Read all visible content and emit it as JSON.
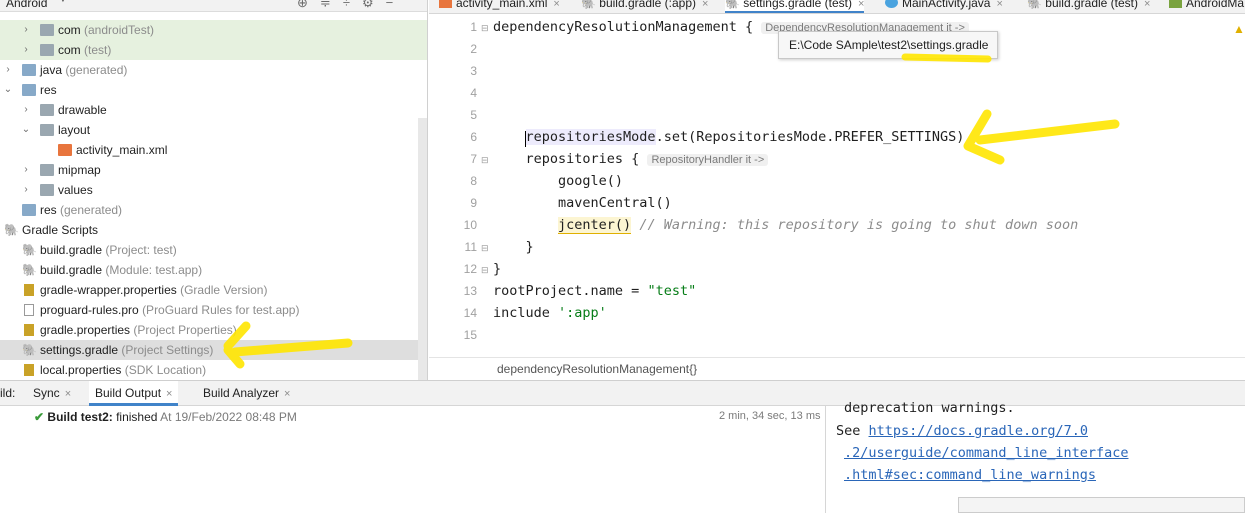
{
  "project_panel": {
    "title": "Android",
    "tree": [
      {
        "label": "com",
        "sub": "(androidTest)"
      },
      {
        "label": "com",
        "sub": "(test)"
      },
      {
        "label": "java",
        "sub": "(generated)"
      },
      {
        "label": "res",
        "sub": ""
      },
      {
        "label": "drawable",
        "sub": ""
      },
      {
        "label": "layout",
        "sub": ""
      },
      {
        "label": "activity_main.xml",
        "sub": ""
      },
      {
        "label": "mipmap",
        "sub": ""
      },
      {
        "label": "values",
        "sub": ""
      },
      {
        "label": "res",
        "sub": "(generated)"
      },
      {
        "label": "Gradle Scripts",
        "sub": ""
      },
      {
        "label": "build.gradle",
        "sub": "(Project: test)"
      },
      {
        "label": "build.gradle",
        "sub": "(Module: test.app)"
      },
      {
        "label": "gradle-wrapper.properties",
        "sub": "(Gradle Version)"
      },
      {
        "label": "proguard-rules.pro",
        "sub": "(ProGuard Rules for test.app)"
      },
      {
        "label": "gradle.properties",
        "sub": "(Project Properties)"
      },
      {
        "label": "settings.gradle",
        "sub": "(Project Settings)"
      },
      {
        "label": "local.properties",
        "sub": "(SDK Location)"
      }
    ]
  },
  "tabs": [
    {
      "label": "activity_main.xml"
    },
    {
      "label": "build.gradle (:app)"
    },
    {
      "label": "settings.gradle (test)"
    },
    {
      "label": "MainActivity.java"
    },
    {
      "label": "build.gradle (test)"
    },
    {
      "label": "AndroidMa"
    }
  ],
  "editor": {
    "line_numbers": [
      "1",
      "2",
      "3",
      "4",
      "5",
      "6",
      "7",
      "8",
      "9",
      "10",
      "11",
      "12",
      "13",
      "14",
      "15"
    ],
    "tooltip": "E:\\Code SAmple\\test2\\settings.gradle",
    "hint_1": "DependencyResolutionManagement it ->",
    "hint_2": "RepositoryHandler it ->",
    "lines": {
      "l1": "dependencyResolutionManagement {",
      "l6_a": "repositoriesMode",
      "l6_b": ".set(RepositoriesMode.PREFER_SETTINGS)",
      "l7": "    repositories {",
      "l8": "        google()",
      "l9": "        mavenCentral()",
      "l10_a": "jcenter()",
      "l10_b": " // Warning: this repository is going to shut down soon",
      "l11": "    }",
      "l12": "}",
      "l13_a": "rootProject.name = ",
      "l13_b": "\"test\"",
      "l14_a": "include ",
      "l14_b": "':app'"
    },
    "breadcrumb": "dependencyResolutionManagement{}"
  },
  "build": {
    "prefix": "ild:",
    "tabs": [
      "Sync",
      "Build Output",
      "Build Analyzer"
    ],
    "status_title": "Build test2:",
    "status_text": "finished",
    "status_time": "At 19/Feb/2022 08:48 PM",
    "duration": "2 min, 34 sec, 13 ms",
    "output": {
      "line1": "deprecation warnings.",
      "see": "See ",
      "link1": "https://docs.gradle.org/7.0",
      "link2": ".2/userguide/command_line_interface",
      "link3": ".html#sec:command_line_warnings"
    }
  },
  "colors": {
    "accent": "#4083c9",
    "annotation": "#ffe600",
    "success": "#3a9b3a",
    "string": "#067d17",
    "link": "#2a66b8"
  }
}
